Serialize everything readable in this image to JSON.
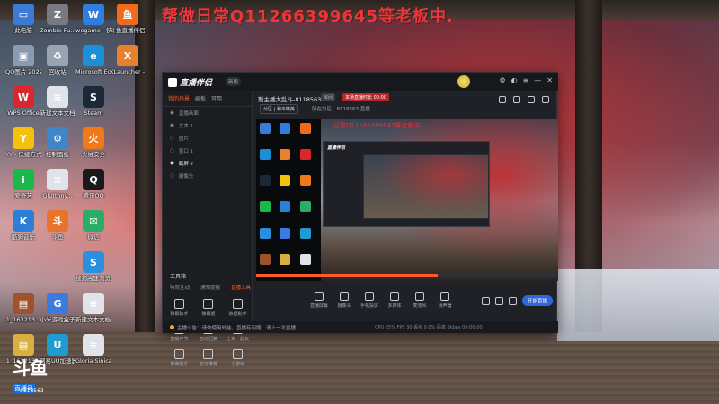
{
  "overlay_text": "帮做日常Q11266399645等老板中.",
  "desktop_icons": [
    {
      "label": "此电脑",
      "color": "#3a7bd5",
      "glyph": "▭",
      "icon": "computer-icon"
    },
    {
      "label": "Zombie Fu...",
      "color": "#777a80",
      "glyph": "Z",
      "icon": "app-icon"
    },
    {
      "label": "wegame - 快捷方式",
      "color": "#2f7de1",
      "glyph": "W",
      "icon": "wegame-icon"
    },
    {
      "label": "斗鱼直播伴侣",
      "color": "#f26a1b",
      "glyph": "鱼",
      "icon": "douyu-icon"
    },
    {
      "label": "QQ图片 20220127...",
      "color": "#8a9bb0",
      "glyph": "▣",
      "icon": "image-icon"
    },
    {
      "label": "回收站",
      "color": "#9aa4b0",
      "glyph": "♻",
      "icon": "recycle-bin-icon"
    },
    {
      "label": "Microsoft Edge",
      "color": "#1b8fd8",
      "glyph": "e",
      "icon": "edge-icon"
    },
    {
      "label": "XLauncher - 快捷方式",
      "color": "#e8812c",
      "glyph": "X",
      "icon": "xlauncher-icon"
    },
    {
      "label": "WPS Office",
      "color": "#d9262f",
      "glyph": "W",
      "icon": "wps-icon"
    },
    {
      "label": "新建文本文档",
      "color": "#e0e4ea",
      "glyph": "≡",
      "icon": "text-file-icon"
    },
    {
      "label": "Steam",
      "color": "#1b2838",
      "glyph": "S",
      "icon": "steam-icon"
    },
    {
      "label": "YY - 快捷方式",
      "color": "#f4c20d",
      "glyph": "Y",
      "icon": "yy-icon"
    },
    {
      "label": "控制面板",
      "color": "#3f86c9",
      "glyph": "⚙",
      "icon": "control-panel-icon"
    },
    {
      "label": "火绒安全",
      "color": "#f07a1a",
      "glyph": "火",
      "icon": "huorong-icon"
    },
    {
      "label": "爱奇艺",
      "color": "#19b84b",
      "glyph": "i",
      "icon": "iqiyi-icon"
    },
    {
      "label": "Gluttony...",
      "color": "#e0e4ea",
      "glyph": "≡",
      "icon": "file-icon"
    },
    {
      "label": "腾讯QQ",
      "color": "#1a1a1a",
      "glyph": "Q",
      "icon": "qq-icon"
    },
    {
      "label": "酷狗音乐",
      "color": "#2b7fd6",
      "glyph": "K",
      "icon": "kugou-icon"
    },
    {
      "label": "斗鱼",
      "color": "#e8732a",
      "glyph": "斗",
      "icon": "game-icon"
    },
    {
      "label": "微信",
      "color": "#2aae67",
      "glyph": "✉",
      "icon": "wechat-icon"
    },
    {
      "label": "搜狗高速浏览器",
      "color": "#2b8fe0",
      "glyph": "S",
      "icon": "sogou-icon"
    },
    {
      "label": "1_163213...",
      "color": "#a0522d",
      "glyph": "▤",
      "icon": "image-icon"
    },
    {
      "label": "小米游戏盒子",
      "color": "#3b7be0",
      "glyph": "G",
      "icon": "mi-game-icon"
    },
    {
      "label": "新建文本文档.txt",
      "color": "#e0e4ea",
      "glyph": "≡",
      "icon": "text-file-icon"
    },
    {
      "label": "1_163213...",
      "color": "#d8b040",
      "glyph": "▤",
      "icon": "image-icon"
    },
    {
      "label": "网易UU加速器",
      "color": "#1f9bd1",
      "glyph": "U",
      "icon": "uu-icon"
    },
    {
      "label": "Gloria Sinica Han Xiong...",
      "color": "#e0e4ea",
      "glyph": "≡",
      "icon": "text-file-icon"
    }
  ],
  "app": {
    "logo": "直播伴侣",
    "version": "新版",
    "tabs": [
      "我的场景",
      "画板",
      "可用"
    ],
    "scenes": [
      {
        "label": "直播画面",
        "visible": true
      },
      {
        "label": "文本 1",
        "visible": true
      },
      {
        "label": "图片",
        "visible": false
      },
      {
        "label": "窗口 1",
        "visible": false
      },
      {
        "label": "截屏 2",
        "visible": true
      },
      {
        "label": "摄像头",
        "visible": false
      }
    ],
    "tools_title": "工具箱",
    "tools_tabs": [
      "特效互动",
      "通知提醒",
      "直播工具"
    ],
    "tools": [
      {
        "label": "弹幕助手",
        "icon": "danmaku-icon"
      },
      {
        "label": "弹幕姬",
        "icon": "danmaku-ji-icon"
      },
      {
        "label": "数据助手",
        "icon": "data-icon"
      },
      {
        "label": "直播环节",
        "icon": "stage-icon"
      },
      {
        "label": "自动回复",
        "icon": "auto-reply-icon"
      },
      {
        "label": "上车一起玩",
        "icon": "together-icon"
      },
      {
        "label": "推荐助手",
        "icon": "recommend-icon"
      },
      {
        "label": "官方推荐",
        "icon": "official-icon"
      },
      {
        "label": "小游戏",
        "icon": "minigame-icon"
      }
    ],
    "room_title": "斯主播大乱斗-8118563",
    "tag_gray": "房间",
    "tag_red": "本场直播时长 00:00",
    "category_btn": "分区 | 和平精英",
    "room_meta": "所在分区：8118563  直播",
    "preview_text": "日常Q11266399645等老板中.",
    "controls": [
      {
        "label": "直播屏幕",
        "icon": "screen-icon"
      },
      {
        "label": "摄像头",
        "icon": "camera-icon"
      },
      {
        "label": "手机投屏",
        "icon": "phone-icon"
      },
      {
        "label": "多媒体",
        "icon": "media-icon"
      },
      {
        "label": "麦克风",
        "icon": "mic-icon"
      },
      {
        "label": "扬声器",
        "icon": "speaker-icon"
      }
    ],
    "start_label": "开始直播",
    "notice": "主播公告：请勿使用外挂，直播有问题，请上一次直播",
    "stats": "CPU 25%  FPS 30  丢帧 0.0%  码率 0kbps  00:00:00"
  },
  "watermark": {
    "big": "斗鱼",
    "sub": "直播号",
    "room_id": "8118563"
  }
}
